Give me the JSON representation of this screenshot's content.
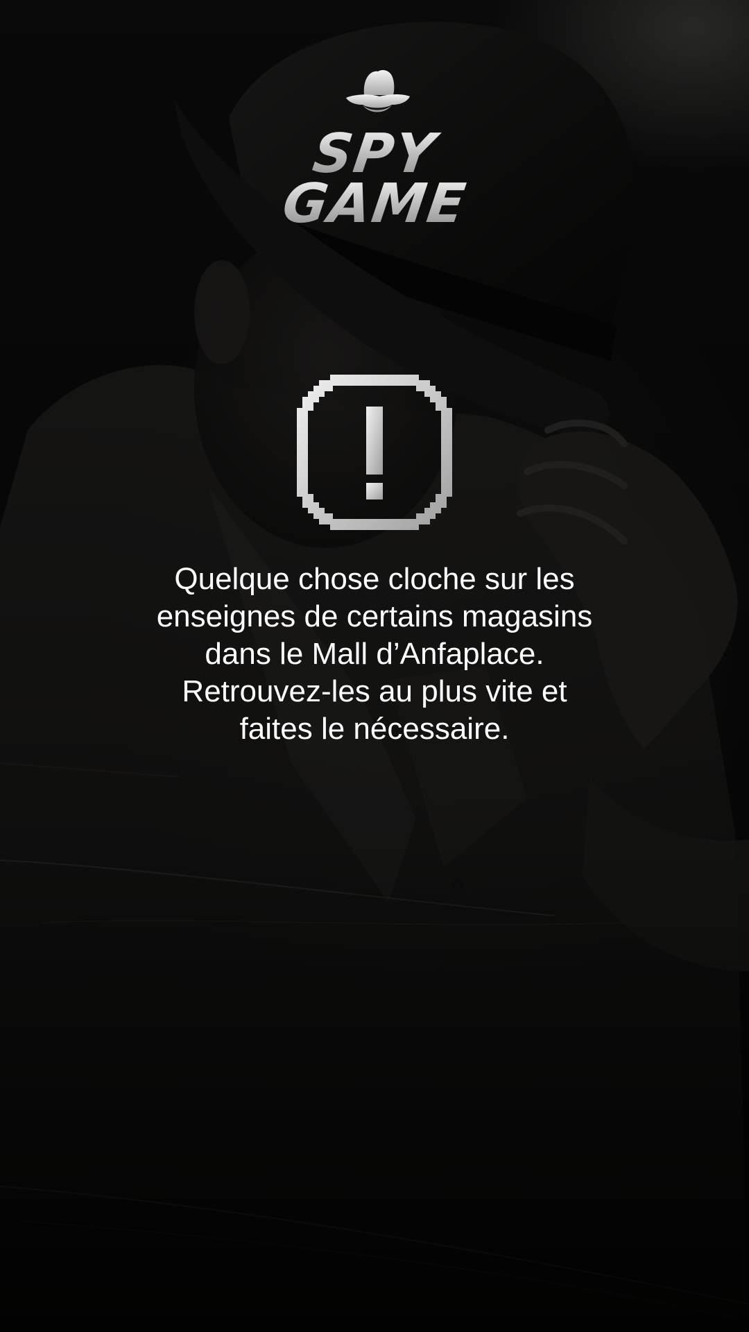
{
  "logo": {
    "line1": "SPY",
    "line2": "GAME",
    "icon": "spy-hat-icon"
  },
  "alert": {
    "icon": "exclamation-alert-icon"
  },
  "message": {
    "lines": [
      "Quelque chose cloche sur les",
      "enseignes de certains magasins",
      "dans le Mall d’Anfaplace.",
      "Retrouvez-les au plus vite et",
      "faites le nécessaire."
    ]
  },
  "colors": {
    "background": "#0b0b0b",
    "text": "#ffffff",
    "metal": "#cfcfcf"
  }
}
